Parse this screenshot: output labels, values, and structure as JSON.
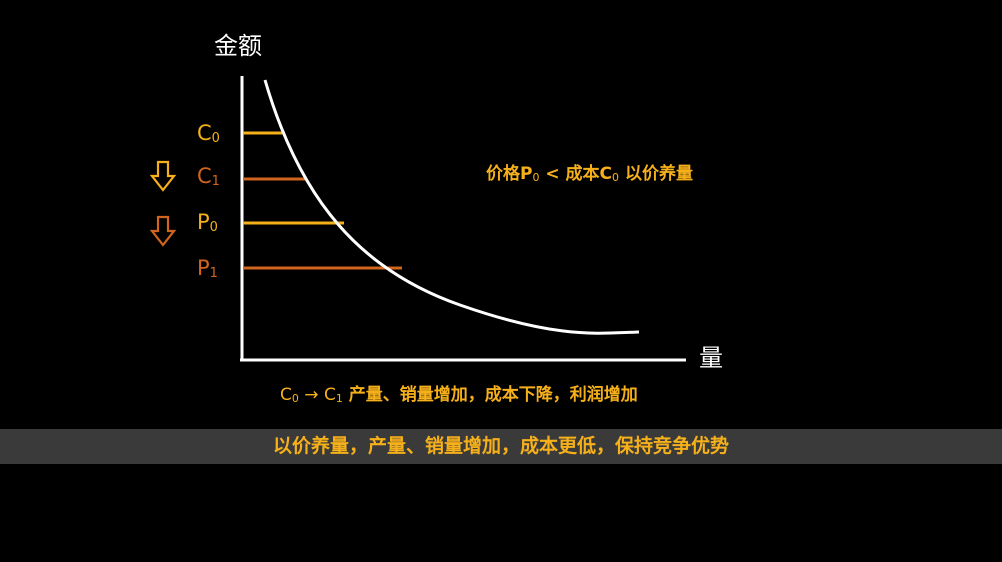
{
  "diagram": {
    "y_axis_label": "金额",
    "x_axis_label": "量",
    "ticks": [
      {
        "id": "c0",
        "main": "C",
        "sub": "0"
      },
      {
        "id": "c1",
        "main": "C",
        "sub": "1"
      },
      {
        "id": "p0",
        "main": "P",
        "sub": "0"
      },
      {
        "id": "p1",
        "main": "P",
        "sub": "1"
      }
    ],
    "arrow_icons": [
      "down-arrow-icon",
      "down-arrow-icon"
    ],
    "note": {
      "part1": "价格P",
      "sub1": "0",
      "part2": " < 成本C",
      "sub2": "0",
      "part3": "  以价养量"
    },
    "summary": {
      "c": "C",
      "sub0": "0",
      "arrow": " → ",
      "c1": "C",
      "sub1": "1",
      "text": " 产量、销量增加，成本下降，利润增加"
    },
    "colors": {
      "yellow": "#f5b01a",
      "orange": "#d2651e",
      "axis": "#ffffff",
      "banner_bg": "#3a3a3a"
    }
  },
  "banner": {
    "text": "以价养量，产量、销量增加，成本更低，保持竞争优势"
  }
}
